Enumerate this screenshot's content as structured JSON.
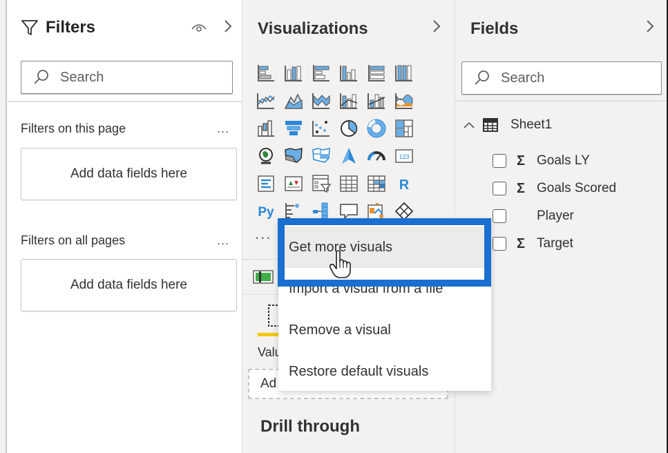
{
  "filters": {
    "title": "Filters",
    "search_placeholder": "Search",
    "sections": [
      {
        "label": "Filters on this page",
        "more": "...",
        "well_text": "Add data fields here"
      },
      {
        "label": "Filters on all pages",
        "more": "...",
        "well_text": "Add data fields here"
      }
    ],
    "icons": [
      "filter-icon",
      "eye-icon",
      "chevron-right-icon",
      "search-icon"
    ]
  },
  "visualizations": {
    "title": "Visualizations",
    "more": "...",
    "icons": [
      "stacked-bar-chart",
      "stacked-column-chart",
      "clustered-bar-chart",
      "clustered-column-chart",
      "100-stacked-bar-chart",
      "100-stacked-column-chart",
      "line-chart",
      "area-chart",
      "stacked-area-chart",
      "line-and-stacked-column-chart",
      "line-and-clustered-column-chart",
      "ribbon-chart",
      "waterfall-chart",
      "funnel",
      "scatter-chart",
      "pie-chart",
      "donut-chart",
      "treemap",
      "map",
      "filled-map",
      "shape-map",
      "azure-map",
      "gauge",
      "card",
      "multi-row-card",
      "kpi",
      "slicer",
      "table",
      "matrix",
      "r-script-visual",
      "python-visual",
      "key-influencers",
      "decomposition-tree",
      "qa",
      "smart-narrative",
      "power-apps"
    ],
    "r_label": "R",
    "py_label": "Py",
    "values_label": "Valu",
    "values_well_text": "Ad",
    "drill_through_title": "Drill through"
  },
  "fields": {
    "title": "Fields",
    "search_placeholder": "Search",
    "table": {
      "name": "Sheet1",
      "expanded": true
    },
    "items": [
      {
        "label": "Goals LY",
        "sigma": "Σ",
        "checked": false
      },
      {
        "label": "Goals Scored",
        "sigma": "Σ",
        "checked": false
      },
      {
        "label": "Player",
        "sigma": "",
        "checked": false
      },
      {
        "label": "Target",
        "sigma": "Σ",
        "checked": false
      }
    ]
  },
  "context_menu": {
    "items": [
      {
        "label": "Get more visuals",
        "hovered": true
      },
      {
        "label": "Import a visual from a file",
        "hovered": false
      },
      {
        "label": "Remove a visual",
        "hovered": false
      },
      {
        "label": "Restore default visuals",
        "hovered": false
      }
    ],
    "highlight_color": "#1a6fd0"
  },
  "colors": {
    "accent_blue": "#2b88d8",
    "highlight_border": "#1a6fd0",
    "tab_underline": "#f2c811",
    "pane_background": "#f3f2f1"
  }
}
